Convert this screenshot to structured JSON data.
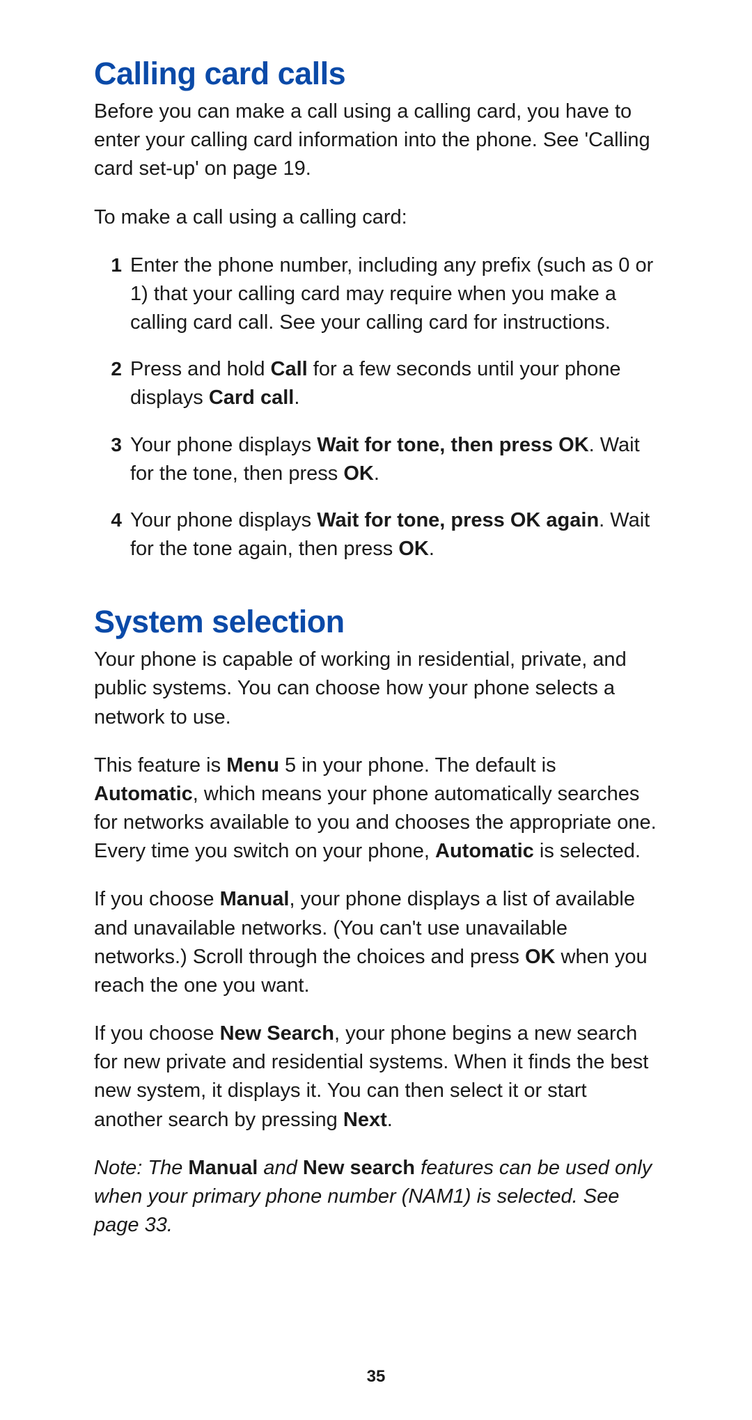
{
  "page_number": "35",
  "sections": {
    "callingCard": {
      "heading": "Calling card calls",
      "intro": "Before you can make a call using a calling card, you have to enter your calling card information into the phone. See 'Calling card set-up' on page 19.",
      "lead": "To make a call using a calling card:",
      "steps": {
        "s1": {
          "num": "1",
          "text": "Enter the phone number, including any prefix (such as 0 or 1) that your calling card may require when you make a calling card call. See your calling card for instructions."
        },
        "s2": {
          "num": "2",
          "pre": "Press and hold ",
          "b1": "Call",
          "mid": " for a few seconds until your phone displays ",
          "b2": "Card call",
          "post": "."
        },
        "s3": {
          "num": "3",
          "pre": "Your phone displays ",
          "b1": "Wait for tone, then press OK",
          "mid": ". Wait for the tone, then press ",
          "b2": "OK",
          "post": "."
        },
        "s4": {
          "num": "4",
          "pre": "Your phone displays ",
          "b1": "Wait for tone, press OK again",
          "mid": ". Wait for the tone again, then press ",
          "b2": "OK",
          "post": "."
        }
      }
    },
    "systemSelection": {
      "heading": "System selection",
      "p1": "Your phone is capable of working in residential, private, and public systems. You can choose how your phone selects a network to use.",
      "p2": {
        "pre": "This feature is ",
        "b1": "Menu",
        "mid1": " 5 in your phone. The default is ",
        "b2": "Automatic",
        "mid2": ", which means your phone automatically searches for networks available to you and chooses the appropriate one. Every time you switch on your phone, ",
        "b3": "Automatic",
        "post": " is selected."
      },
      "p3": {
        "pre": "If you choose ",
        "b1": "Manual",
        "mid": ", your phone displays a list of available and unavailable networks. (You can't use unavailable networks.) Scroll through the choices and press ",
        "b2": "OK",
        "post": " when you reach the one you want."
      },
      "p4": {
        "pre": "If you choose ",
        "b1": "New Search",
        "mid": ", your phone begins a new search for new private and residential systems. When it finds the best new system, it displays it. You can then select it or start another search by pressing ",
        "b2": "Next",
        "post": "."
      },
      "note": {
        "lead": "Note:  The ",
        "b1": "Manual",
        "mid1": " and ",
        "b2": "New search",
        "mid2": " features can be used only when your primary phone number (NAM1) is selected. See page 33."
      }
    }
  }
}
